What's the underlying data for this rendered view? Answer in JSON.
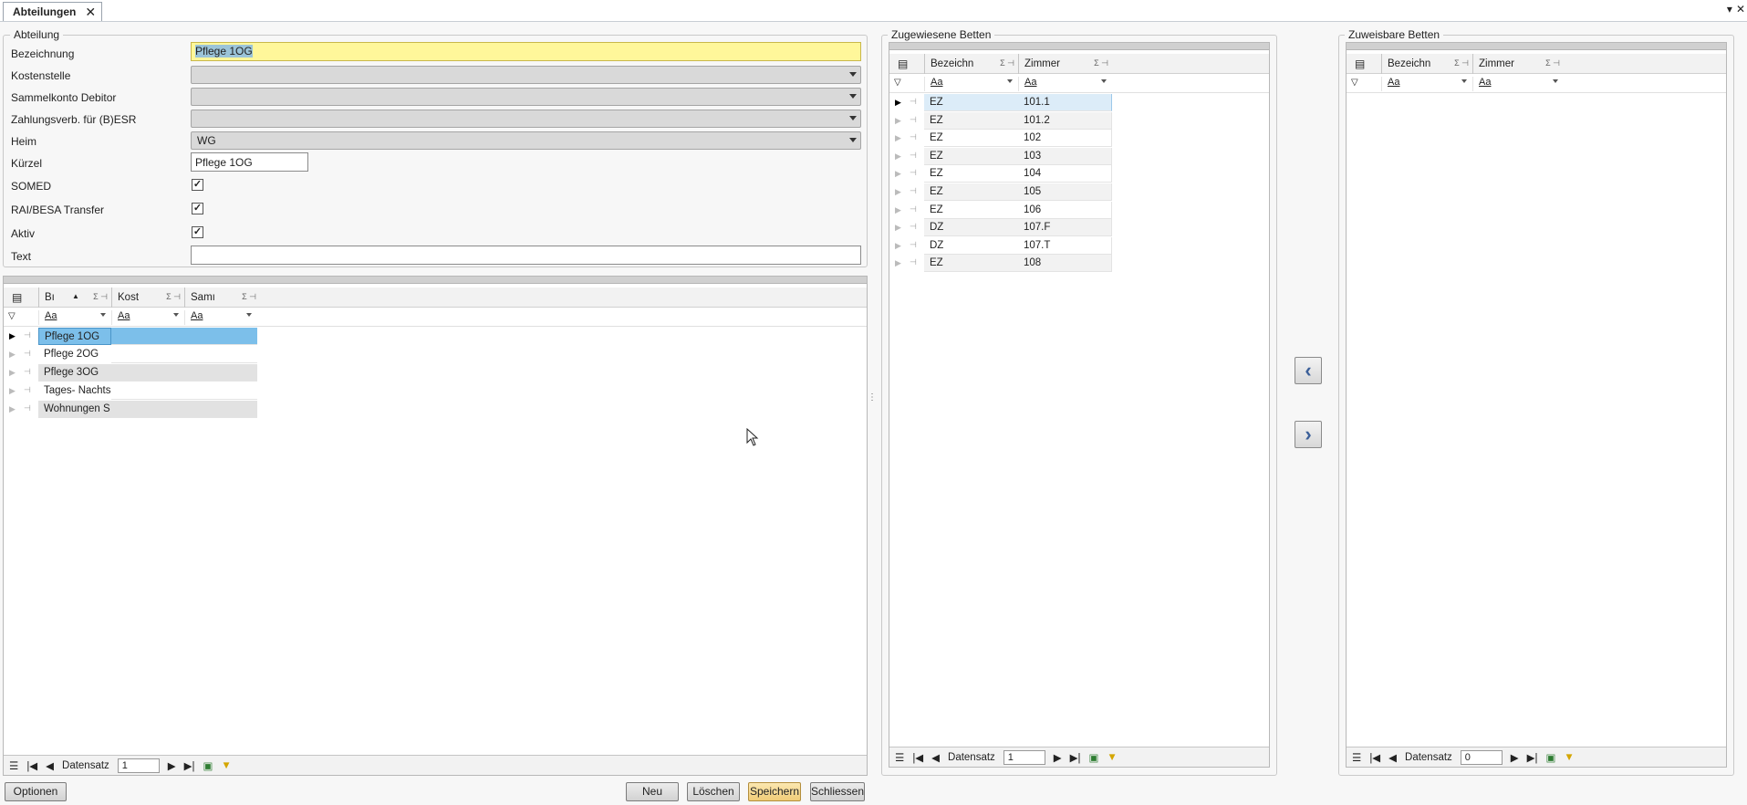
{
  "tab": {
    "title": "Abteilungen",
    "close": "✕"
  },
  "window": {
    "menu_glyph": "▾",
    "close_glyph": "✕"
  },
  "form": {
    "group_title": "Abteilung",
    "bezeichnung": {
      "label": "Bezeichnung",
      "value": "Pflege 1OG"
    },
    "kostenstelle": {
      "label": "Kostenstelle",
      "value": ""
    },
    "sammelkonto": {
      "label": "Sammelkonto Debitor",
      "value": ""
    },
    "zahlungsverb": {
      "label": "Zahlungsverb. für (B)ESR",
      "value": ""
    },
    "heim": {
      "label": "Heim",
      "value": "WG"
    },
    "kuerzel": {
      "label": "Kürzel",
      "value": "Pflege 1OG"
    },
    "somed": {
      "label": "SOMED",
      "checked": true,
      "mark": "✓"
    },
    "rai": {
      "label": "RAI/BESA Transfer",
      "checked": true,
      "mark": "✓"
    },
    "aktiv": {
      "label": "Aktiv",
      "checked": true,
      "mark": "✓"
    },
    "text": {
      "label": "Text",
      "value": ""
    }
  },
  "dept_grid": {
    "columns": [
      "Bı",
      "Kost",
      "Samı"
    ],
    "filter": [
      "Aa",
      "Aa",
      "Aa"
    ],
    "rows": [
      "Pflege 1OG",
      "Pflege 2OG",
      "Pflege 3OG",
      "Tages- Nachts",
      "Wohnungen S"
    ],
    "nav_label": "Datensatz",
    "nav_value": "1"
  },
  "assigned": {
    "title": "Zugewiesene Betten",
    "columns": [
      "Bezeichn",
      "Zimmer"
    ],
    "filter": [
      "Aa",
      "Aa"
    ],
    "rows": [
      {
        "bez": "EZ",
        "zimmer": "101.1"
      },
      {
        "bez": "EZ",
        "zimmer": "101.2"
      },
      {
        "bez": "EZ",
        "zimmer": "102"
      },
      {
        "bez": "EZ",
        "zimmer": "103"
      },
      {
        "bez": "EZ",
        "zimmer": "104"
      },
      {
        "bez": "EZ",
        "zimmer": "105"
      },
      {
        "bez": "EZ",
        "zimmer": "106"
      },
      {
        "bez": "DZ",
        "zimmer": "107.F"
      },
      {
        "bez": "DZ",
        "zimmer": "107.T"
      },
      {
        "bez": "EZ",
        "zimmer": "108"
      }
    ],
    "nav_label": "Datensatz",
    "nav_value": "1"
  },
  "assignable": {
    "title": "Zuweisbare Betten",
    "columns": [
      "Bezeichn",
      "Zimmer"
    ],
    "filter": [
      "Aa",
      "Aa"
    ],
    "nav_label": "Datensatz",
    "nav_value": "0"
  },
  "move_buttons": {
    "left": "‹",
    "right": "›"
  },
  "buttons": {
    "optionen": "Optionen",
    "neu": "Neu",
    "loeschen": "Löschen",
    "speichern": "Speichern",
    "schliessen": "Schliessen"
  },
  "colors": {
    "accent_selected": "#7cbfea",
    "required_yellow": "#fff79a",
    "save_button": "#f5d98e"
  }
}
